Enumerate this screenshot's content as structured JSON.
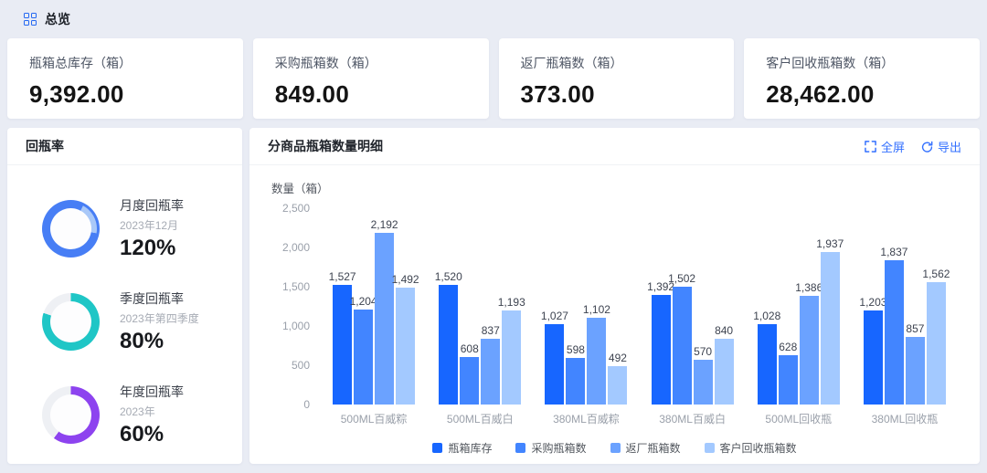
{
  "page": {
    "title": "总览"
  },
  "stat_cards": [
    {
      "label": "瓶箱总库存（箱）",
      "value": "9,392.00"
    },
    {
      "label": "采购瓶箱数（箱）",
      "value": "849.00"
    },
    {
      "label": "返厂瓶箱数（箱）",
      "value": "373.00"
    },
    {
      "label": "客户回收瓶箱数（箱）",
      "value": "28,462.00"
    }
  ],
  "return_rate_panel": {
    "title": "回瓶率",
    "gauges": [
      {
        "name": "月度回瓶率",
        "period": "2023年12月",
        "value": "120%",
        "percent": 120,
        "color": "#477ef5",
        "overflow_color": "#a9c8f8"
      },
      {
        "name": "季度回瓶率",
        "period": "2023年第四季度",
        "value": "80%",
        "percent": 80,
        "color": "#1fc6c6"
      },
      {
        "name": "年度回瓶率",
        "period": "2023年",
        "value": "60%",
        "percent": 60,
        "color": "#8d43ef"
      }
    ],
    "track_color": "#eef0f4"
  },
  "detail_panel": {
    "title": "分商品瓶箱数量明细",
    "fullscreen_label": "全屏",
    "export_label": "导出",
    "accent_color": "#3370ff"
  },
  "chart_data": {
    "type": "bar",
    "title": "分商品瓶箱数量明细",
    "ylabel": "数量（箱）",
    "ylim": [
      0,
      2500
    ],
    "yticks": [
      "0",
      "500",
      "1,000",
      "1,500",
      "2,000",
      "2,500"
    ],
    "grid": false,
    "legend_position": "bottom",
    "categories": [
      "500ML百威粽",
      "500ML百威白",
      "380ML百威粽",
      "380ML百威白",
      "500ML回收瓶",
      "380ML回收瓶"
    ],
    "series": [
      {
        "name": "瓶箱库存",
        "color": "#1766ff",
        "values": [
          1527,
          1520,
          1027,
          1392,
          1028,
          1203
        ]
      },
      {
        "name": "采购瓶箱数",
        "color": "#4285ff",
        "values": [
          1204,
          608,
          598,
          1502,
          628,
          1837
        ]
      },
      {
        "name": "返厂瓶箱数",
        "color": "#6ba2ff",
        "values": [
          2192,
          837,
          1102,
          570,
          1386,
          857
        ]
      },
      {
        "name": "客户回收瓶箱数",
        "color": "#a3c9ff",
        "values": [
          1492,
          1193,
          492,
          840,
          1937,
          1562
        ]
      }
    ]
  }
}
